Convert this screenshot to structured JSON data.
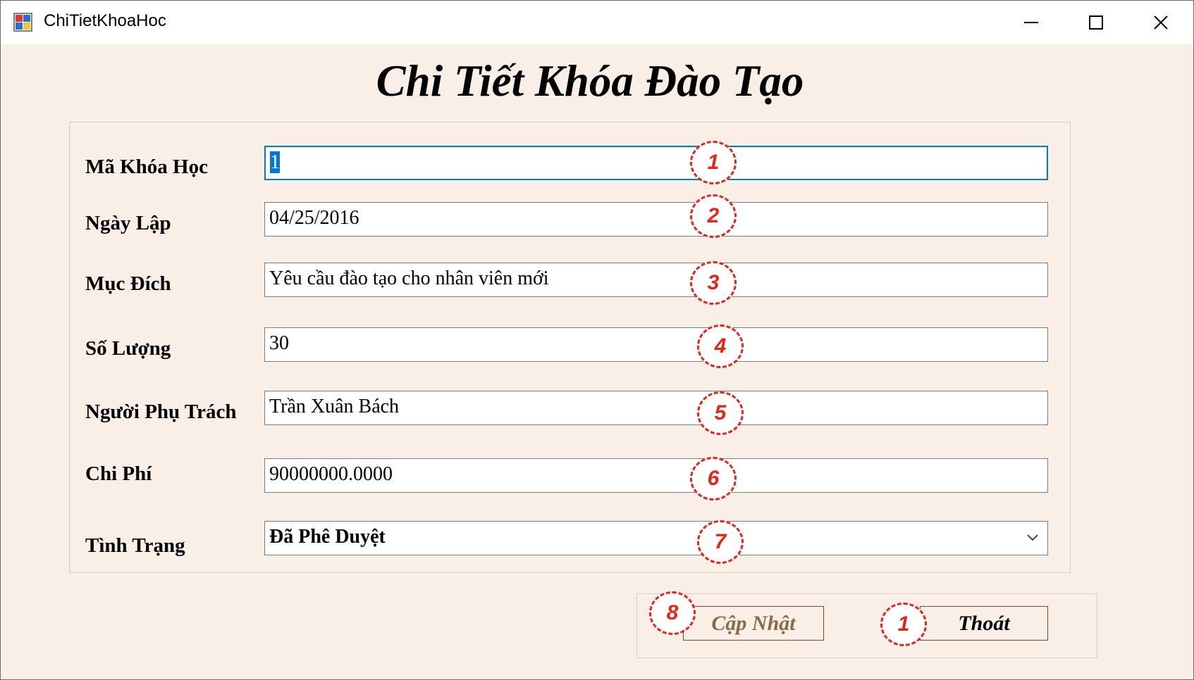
{
  "window": {
    "title": "ChiTietKhoaHoc",
    "controls": [
      "minimize",
      "maximize",
      "close"
    ]
  },
  "form": {
    "heading": "Chi Tiết Khóa Đào Tạo",
    "fields": [
      {
        "label": "Mã Khóa Học",
        "value": "1",
        "badge": "1"
      },
      {
        "label": "Ngày Lập",
        "value": "04/25/2016",
        "badge": "2"
      },
      {
        "label": "Mục Đích",
        "value": "Yêu cầu đào tạo cho nhân viên mới",
        "badge": "3"
      },
      {
        "label": "Số Lượng",
        "value": "30",
        "badge": "4"
      },
      {
        "label": "Người Phụ Trách",
        "value": "Trần Xuân Bách",
        "badge": "5"
      },
      {
        "label": "Chi Phí",
        "value": "90000000.0000",
        "badge": "6"
      },
      {
        "label": "Tình Trạng",
        "value": "Đã Phê Duyệt",
        "badge": "7"
      }
    ]
  },
  "buttons": {
    "update_label": "Cập Nhật",
    "update_badge": "8",
    "exit_label": "Thoát",
    "exit_badge": "1"
  },
  "colors": {
    "form_background": "#faefe6",
    "badge_red": "#e8241a",
    "focus_blue": "#0078d7",
    "button_border": "#8b4513"
  }
}
